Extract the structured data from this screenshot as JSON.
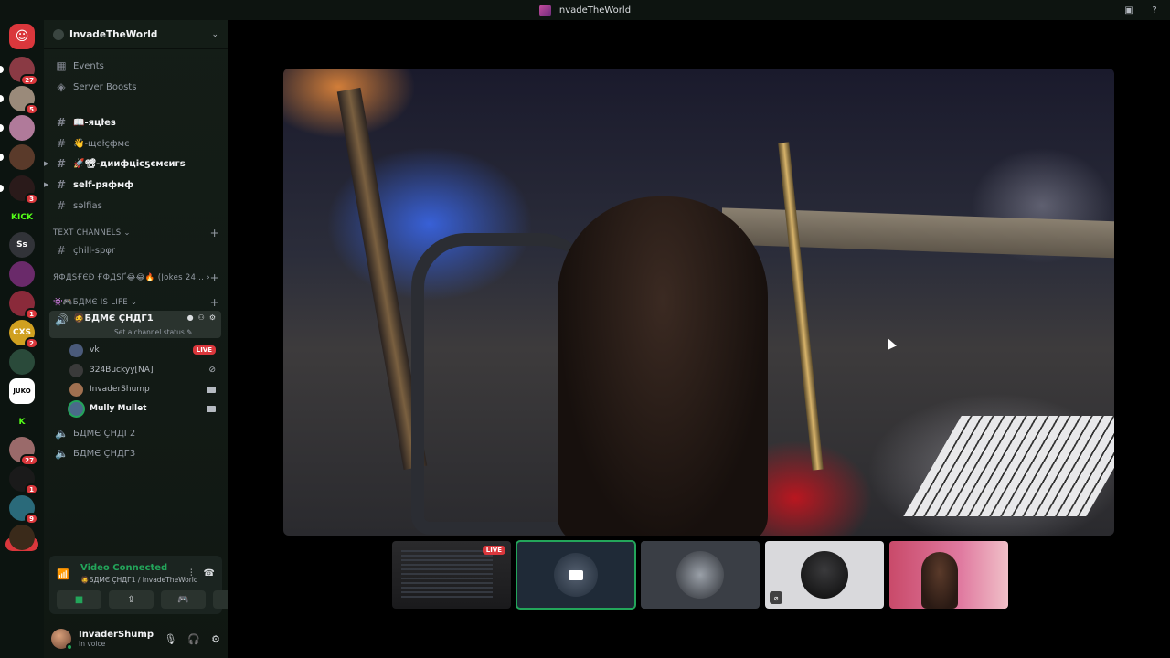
{
  "window": {
    "title": "InvadeTheWorld"
  },
  "rail": {
    "servers": [
      {
        "name": "discord-home-icon",
        "color": "#da373c",
        "badge": ""
      },
      {
        "name": "server-1",
        "color": "#8a3a44",
        "badge": "27"
      },
      {
        "name": "server-2",
        "color": "#9a8a7a",
        "badge": "5"
      },
      {
        "name": "server-3",
        "color": "#b07a9a",
        "badge": ""
      },
      {
        "name": "server-4",
        "color": "#5a3a2a",
        "badge": ""
      },
      {
        "name": "server-5",
        "color": "#2a1a1a",
        "badge": "3"
      },
      {
        "name": "kick-server",
        "color": "#0c1410",
        "label": "KICK",
        "badge": ""
      },
      {
        "name": "ss-server",
        "color": "#313338",
        "label": "Ss",
        "badge": ""
      },
      {
        "name": "server-8",
        "color": "#6a2a6a",
        "badge": ""
      },
      {
        "name": "server-9",
        "color": "#8a2a3a",
        "badge": "1"
      },
      {
        "name": "cxs-server",
        "color": "#d0a020",
        "label": "CXS",
        "badge": "2"
      },
      {
        "name": "server-11",
        "color": "#2a4a3a",
        "badge": ""
      },
      {
        "name": "juko-server",
        "color": "#ffffff",
        "label": "JUKO",
        "badge": ""
      },
      {
        "name": "k-server",
        "color": "#0c1410",
        "label": "K",
        "badge": ""
      },
      {
        "name": "server-14",
        "color": "#9a6a6a",
        "badge": "27"
      },
      {
        "name": "server-15",
        "color": "#1a1a1a",
        "badge": "1"
      },
      {
        "name": "server-16",
        "color": "#2a6a7a",
        "badge": "9"
      },
      {
        "name": "server-17",
        "color": "#3a2a1a",
        "badge": ""
      }
    ],
    "new_label": "NEW"
  },
  "sidebar": {
    "guild_name": "InvadeTheWorld",
    "top_items": [
      {
        "label": "Events"
      },
      {
        "label": "Server Boosts"
      }
    ],
    "channels": [
      {
        "label": "📖-яцłes",
        "bright": true
      },
      {
        "label": "👋-щеłçфмє",
        "bright": false
      },
      {
        "label": "🚀📽-диифцісƽємєигѕ",
        "bright": true
      },
      {
        "label": "self-ряфмф",
        "bright": true
      },
      {
        "label": "sǝlfias",
        "bright": false
      }
    ],
    "categories": {
      "text": "TEXT CHANNELS",
      "random": "ЯФДЅҒЄĐ ҒФДЅҐ😂😂🔥 (Jokes 24...",
      "game": "👾🎮БДМЄ IS LIFE"
    },
    "chill_channel": "çhill-spφr",
    "voice": {
      "active": "🧔БДМЄ ÇНДГ1",
      "status_prompt": "Set a channel status",
      "others": [
        "БДМЄ ÇНДГ2",
        "БДМЄ ÇНДГ3"
      ],
      "users": [
        {
          "name": "vk",
          "live": "LIVE",
          "bright": false
        },
        {
          "name": "324Buckyy[NA]",
          "live": "",
          "bright": false
        },
        {
          "name": "InvaderShump",
          "live": "",
          "bright": false
        },
        {
          "name": "Mully Mullet",
          "live": "",
          "bright": true
        }
      ]
    },
    "voice_panel": {
      "status": "Video Connected",
      "location": "🧔БДМЄ ÇНДГ1 / InvadeTheWorld"
    },
    "user": {
      "name": "InvaderShump",
      "status": "In voice"
    }
  },
  "stage": {
    "thumb_live": "LIVE"
  }
}
